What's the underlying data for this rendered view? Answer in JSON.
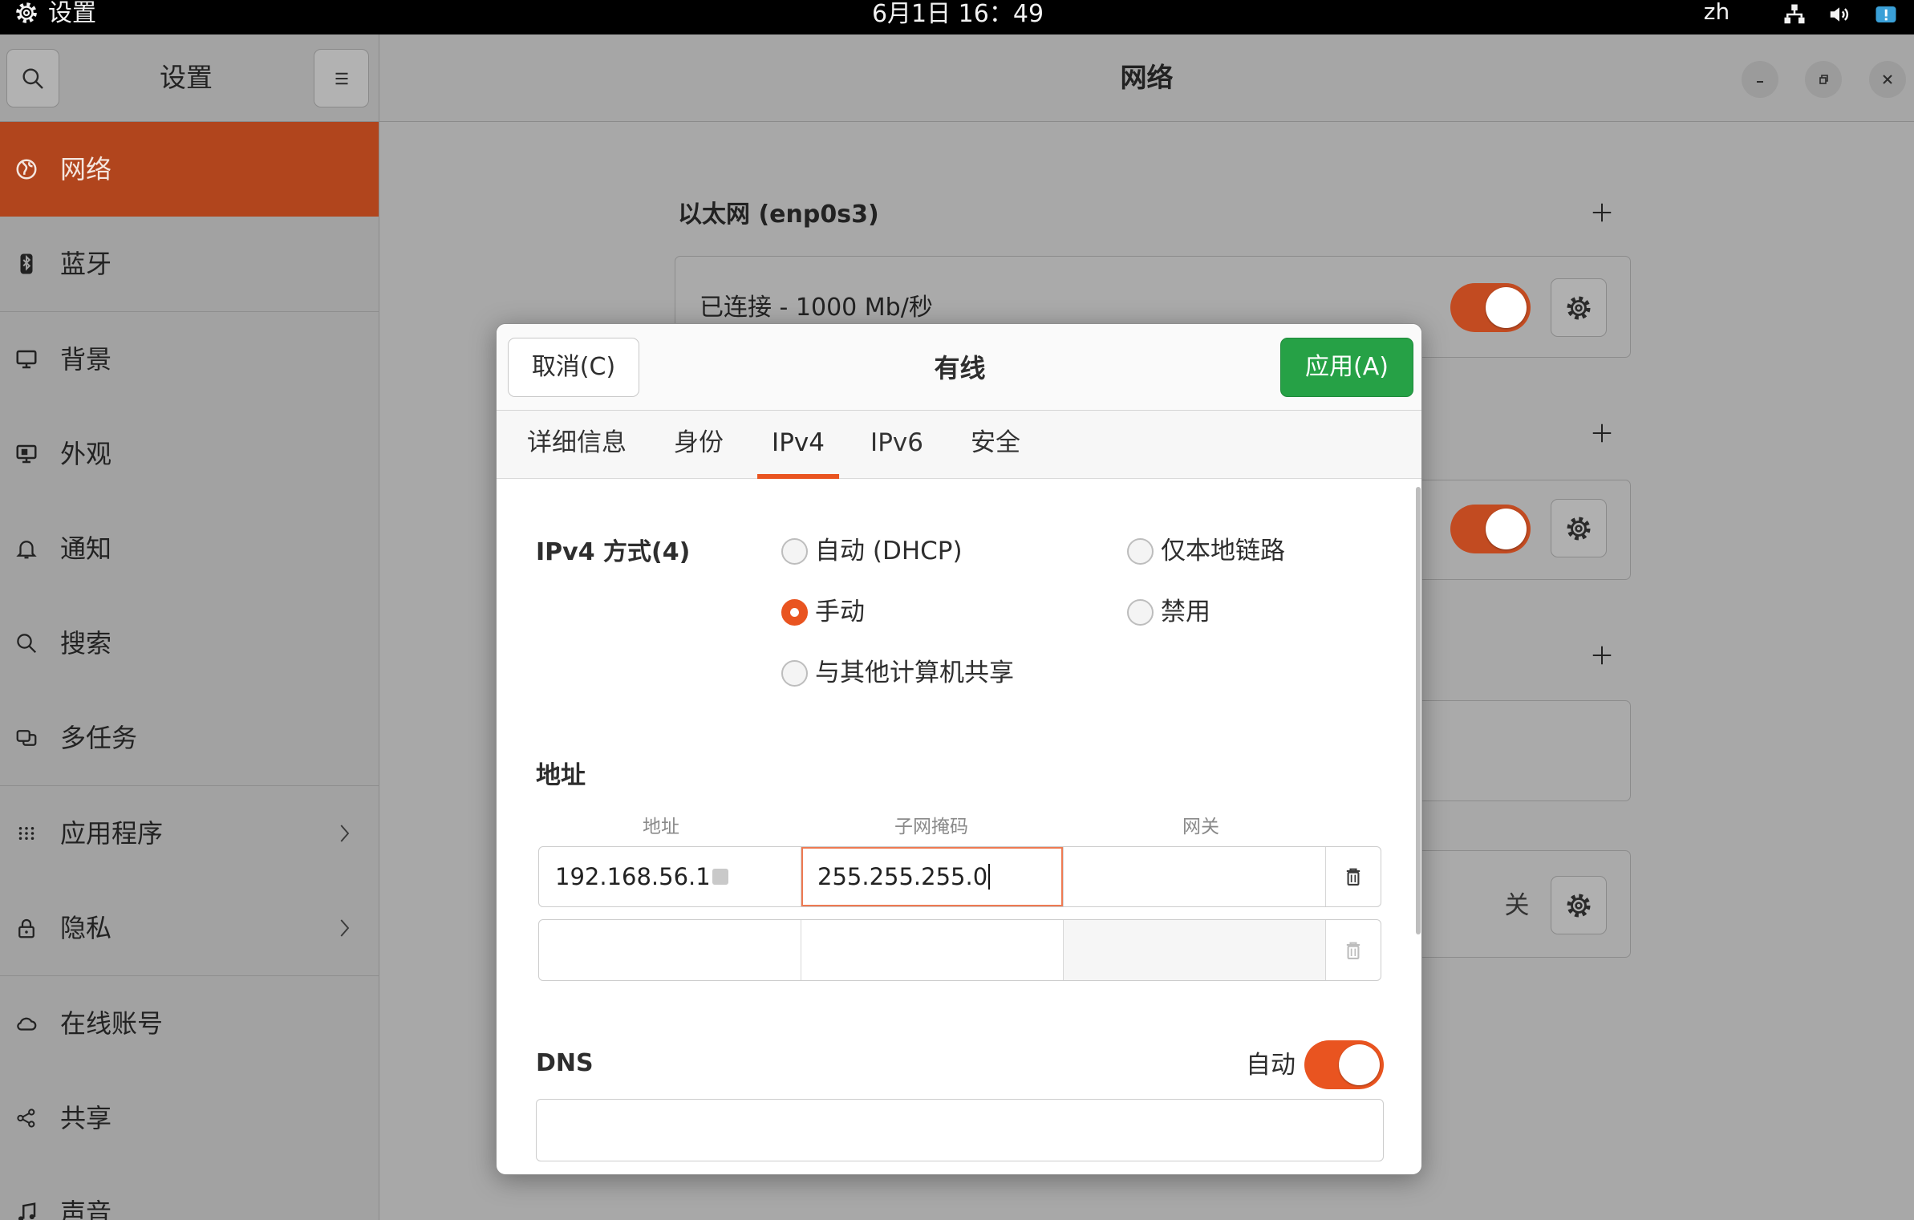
{
  "top_bar": {
    "app_icon": "gear-icon",
    "app_name": "设置",
    "clock": "6月1日 16：49",
    "input_method": "zh",
    "status_icons": [
      "network-wired-icon",
      "volume-icon",
      "alert-icon"
    ]
  },
  "sidebar": {
    "title": "设置",
    "search_icon": "search-icon",
    "menu_icon": "hamburger-menu-icon",
    "items": [
      {
        "label": "网络",
        "icon": "network-icon",
        "selected": true
      },
      {
        "label": "蓝牙",
        "icon": "bluetooth-icon",
        "selected": false
      },
      {
        "label": "背景",
        "icon": "background-icon",
        "selected": false
      },
      {
        "label": "外观",
        "icon": "appearance-icon",
        "selected": false
      },
      {
        "label": "通知",
        "icon": "bell-icon",
        "selected": false
      },
      {
        "label": "搜索",
        "icon": "search-icon",
        "selected": false
      },
      {
        "label": "多任务",
        "icon": "multitasking-icon",
        "selected": false
      },
      {
        "label": "应用程序",
        "icon": "apps-grid-icon",
        "selected": false,
        "trailing_icon": "chevron-right-icon"
      },
      {
        "label": "隐私",
        "icon": "lock-icon",
        "selected": false,
        "trailing_icon": "chevron-right-icon"
      },
      {
        "label": "在线账号",
        "icon": "cloud-icon",
        "selected": false
      },
      {
        "label": "共享",
        "icon": "share-icon",
        "selected": false
      },
      {
        "label": "声音",
        "icon": "music-note-icon",
        "selected": false
      }
    ]
  },
  "window": {
    "title": "网络",
    "controls": [
      "minimize-icon",
      "restore-icon",
      "close-icon"
    ]
  },
  "network_page": {
    "ethernet_heading": "以太网 (enp0s3)",
    "ethernet_status": "已连接 - 1000 Mb/秒",
    "ethernet_enabled": true,
    "second_connection_enabled": true,
    "fourth_connection_state": "关",
    "add_icon": "plus-icon",
    "settings_icon": "gear-icon"
  },
  "dialog": {
    "title": "有线",
    "cancel_label": "取消(C)",
    "apply_label": "应用(A)",
    "tabs": [
      {
        "label": "详细信息",
        "active": false
      },
      {
        "label": "身份",
        "active": false
      },
      {
        "label": "IPv4",
        "active": true
      },
      {
        "label": "IPv6",
        "active": false
      },
      {
        "label": "安全",
        "active": false
      }
    ],
    "ipv4_method_label": "IPv4 方式(4)",
    "methods": [
      {
        "label": "自动 (DHCP)",
        "selected": false
      },
      {
        "label": "仅本地链路",
        "selected": false
      },
      {
        "label": "手动",
        "selected": true
      },
      {
        "label": "禁用",
        "selected": false
      },
      {
        "label": "与其他计算机共享",
        "selected": false
      }
    ],
    "address_section_label": "地址",
    "address_columns": [
      "地址",
      "子网掩码",
      "网关"
    ],
    "address_rows": [
      {
        "address": "192.168.56.1",
        "netmask": "255.255.255.0",
        "gateway": ""
      },
      {
        "address": "",
        "netmask": "",
        "gateway": ""
      }
    ],
    "delete_icon": "trash-icon",
    "dns_label": "DNS",
    "dns_auto_label": "自动",
    "dns_auto": true,
    "dns_value": ""
  },
  "colors": {
    "accent": "#e95420",
    "apply_button": "#26a146",
    "top_bar": "#000000"
  }
}
